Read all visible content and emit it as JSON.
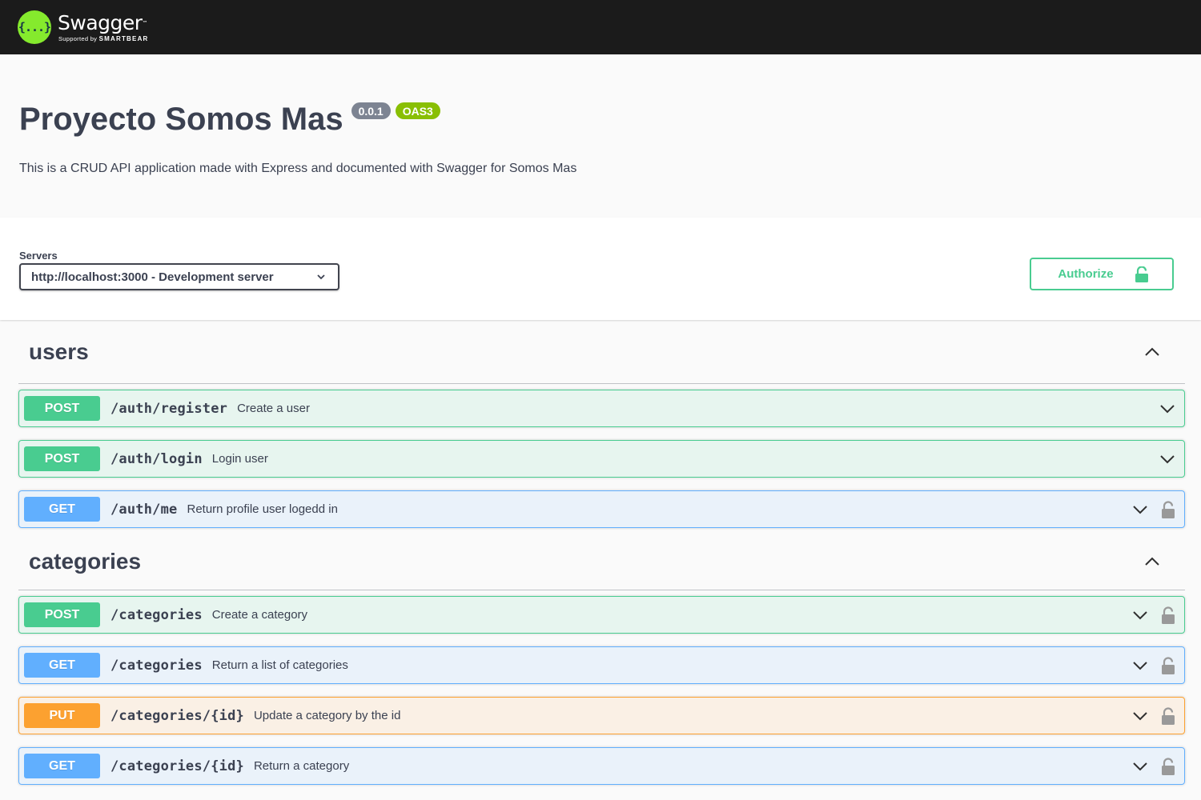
{
  "topbar": {
    "logo_symbol": "{...}",
    "logo_name": "Swagger",
    "logo_tm": "™",
    "logo_supported": "Supported by",
    "logo_brand": "SMARTBEAR"
  },
  "info": {
    "title": "Proyecto Somos Mas",
    "version": "0.0.1",
    "oas": "OAS3",
    "description": "This is a CRUD API application made with Express and documented with Swagger for Somos Mas"
  },
  "servers": {
    "label": "Servers",
    "selected": "http://localhost:3000 - Development server"
  },
  "authorize": {
    "label": "Authorize",
    "icon": "unlocked-lock-icon"
  },
  "colors": {
    "post": "#49cc90",
    "get": "#61affe",
    "put": "#fca130",
    "swagger_green": "#85ea2d",
    "topbar": "#1b1b1b"
  },
  "tags": [
    {
      "name": "users",
      "operations": [
        {
          "method": "POST",
          "path": "/auth/register",
          "summary": "Create a user",
          "locked": false
        },
        {
          "method": "POST",
          "path": "/auth/login",
          "summary": "Login user",
          "locked": false
        },
        {
          "method": "GET",
          "path": "/auth/me",
          "summary": "Return profile user logedd in",
          "locked": true
        }
      ]
    },
    {
      "name": "categories",
      "operations": [
        {
          "method": "POST",
          "path": "/categories",
          "summary": "Create a category",
          "locked": true
        },
        {
          "method": "GET",
          "path": "/categories",
          "summary": "Return a list of categories",
          "locked": true
        },
        {
          "method": "PUT",
          "path": "/categories/{id}",
          "summary": "Update a category by the id",
          "locked": true
        },
        {
          "method": "GET",
          "path": "/categories/{id}",
          "summary": "Return a category",
          "locked": true
        }
      ]
    }
  ]
}
